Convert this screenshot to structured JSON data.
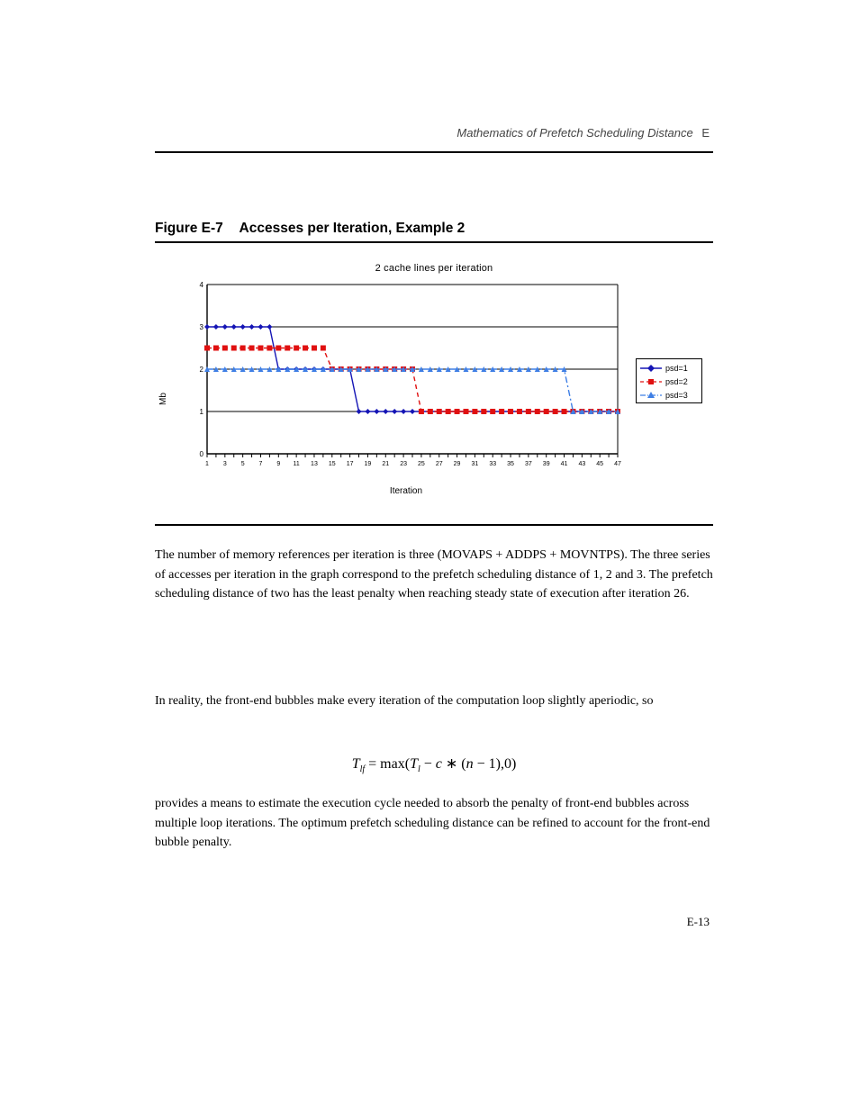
{
  "header": {
    "appendix_label": "Mathematics of Prefetch Scheduling Distance",
    "appendix_num": "E"
  },
  "figure": {
    "label": "Figure E-7",
    "title": "Accesses per Iteration, Example 2"
  },
  "chart_data": {
    "type": "line",
    "title": "2 cache lines per iteration",
    "xlabel": "Iteration",
    "ylabel": "Mb",
    "xlim": [
      1,
      47
    ],
    "ylim": [
      0,
      4
    ],
    "yticks": [
      0,
      1,
      2,
      3,
      4
    ],
    "series": [
      {
        "name": "psd=1",
        "color": "#1515b5",
        "marker": "diamond",
        "dash": "solid",
        "x": [
          1,
          2,
          3,
          4,
          5,
          6,
          7,
          8,
          9,
          10,
          11,
          12,
          13,
          14,
          15,
          16,
          17,
          18,
          19,
          20,
          21,
          22,
          23,
          24,
          25,
          26,
          27,
          28,
          29,
          30,
          31,
          32,
          33,
          34,
          35,
          36,
          37,
          38,
          39,
          40,
          41,
          42,
          43,
          44,
          45,
          46,
          47
        ],
        "y": [
          3,
          3,
          3,
          3,
          3,
          3,
          3,
          3,
          2,
          2,
          2,
          2,
          2,
          2,
          2,
          2,
          2,
          1,
          1,
          1,
          1,
          1,
          1,
          1,
          1,
          1,
          1,
          1,
          1,
          1,
          1,
          1,
          1,
          1,
          1,
          1,
          1,
          1,
          1,
          1,
          1,
          1,
          1,
          1,
          1,
          1,
          1
        ]
      },
      {
        "name": "psd=2",
        "color": "#e01010",
        "marker": "square",
        "dash": "dash",
        "x": [
          1,
          2,
          3,
          4,
          5,
          6,
          7,
          8,
          9,
          10,
          11,
          12,
          13,
          14,
          15,
          16,
          17,
          18,
          19,
          20,
          21,
          22,
          23,
          24,
          25,
          26,
          27,
          28,
          29,
          30,
          31,
          32,
          33,
          34,
          35,
          36,
          37,
          38,
          39,
          40,
          41,
          42,
          43,
          44,
          45,
          46,
          47
        ],
        "y": [
          2.5,
          2.5,
          2.5,
          2.5,
          2.5,
          2.5,
          2.5,
          2.5,
          2.5,
          2.5,
          2.5,
          2.5,
          2.5,
          2.5,
          2,
          2,
          2,
          2,
          2,
          2,
          2,
          2,
          2,
          2,
          1,
          1,
          1,
          1,
          1,
          1,
          1,
          1,
          1,
          1,
          1,
          1,
          1,
          1,
          1,
          1,
          1,
          1,
          1,
          1,
          1,
          1,
          1
        ]
      },
      {
        "name": "psd=3",
        "color": "#3f7fe5",
        "marker": "triangle",
        "dash": "dashdot",
        "x": [
          1,
          2,
          3,
          4,
          5,
          6,
          7,
          8,
          9,
          10,
          11,
          12,
          13,
          14,
          15,
          16,
          17,
          18,
          19,
          20,
          21,
          22,
          23,
          24,
          25,
          26,
          27,
          28,
          29,
          30,
          31,
          32,
          33,
          34,
          35,
          36,
          37,
          38,
          39,
          40,
          41,
          42,
          43,
          44,
          45,
          46,
          47
        ],
        "y": [
          2,
          2,
          2,
          2,
          2,
          2,
          2,
          2,
          2,
          2,
          2,
          2,
          2,
          2,
          2,
          2,
          2,
          2,
          2,
          2,
          2,
          2,
          2,
          2,
          2,
          2,
          2,
          2,
          2,
          2,
          2,
          2,
          2,
          2,
          2,
          2,
          2,
          2,
          2,
          2,
          2,
          1,
          1,
          1,
          1,
          1,
          1
        ]
      }
    ]
  },
  "body": {
    "para1": "The number of memory references per iteration is three (MOVAPS + ADDPS + MOVNTPS). The three series of accesses per iteration in the graph correspond to the prefetch scheduling distance of 1, 2 and 3. The prefetch scheduling distance of two has the least penalty when reaching steady state of execution after iteration 26.",
    "para2": "In reality, the front-end bubbles make every iteration of the computation loop slightly aperiodic, so",
    "formula_html": "<i>T<span class='sub'>lf</span></i> <span class='rm'>= max(</span><i>T<span class='sub'>l</span></i> <span class='rm'>&minus;</span> <i>c</i> <span class='rm'>&lowast; (</span><i>n</i> <span class='rm'>&minus; 1),0)</span>",
    "para3": "provides a means to estimate the execution cycle needed to absorb the penalty of front-end bubbles across multiple loop iterations. The optimum prefetch scheduling distance can be refined to account for the front-end bubble penalty."
  },
  "footer": {
    "page_num": "E-13"
  }
}
